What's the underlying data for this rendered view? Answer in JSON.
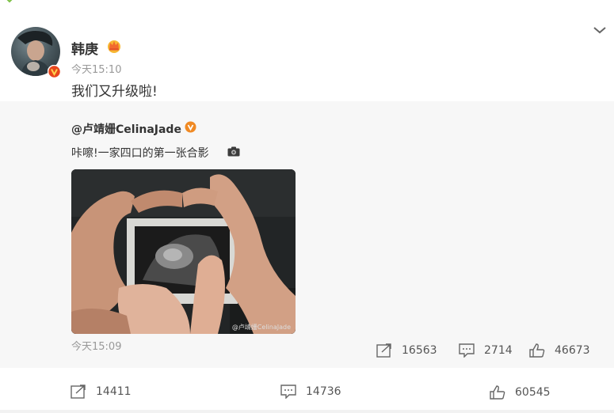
{
  "post": {
    "username": "韩庚",
    "time": "今天15:10",
    "text": "我们又升级啦!",
    "icons": {
      "avatar": "avatar-photo",
      "verified": "verified-v-icon",
      "crown": "crown-icon",
      "menu": "chevron-down-icon"
    }
  },
  "repost": {
    "author": "@卢靖姗CelinaJade",
    "text": "咔嚓!一家四口的第一张合影",
    "image_watermark": "@卢靖姗CelinaJade",
    "time": "今天15:09",
    "stats": {
      "share": "16563",
      "comment": "2714",
      "like": "46673"
    }
  },
  "actions": {
    "share": "14411",
    "comment": "14736",
    "like": "60545"
  },
  "colors": {
    "accent_orange": "#f08a24",
    "verified_badge": "#e8461c",
    "repost_bg": "#f7f7f7",
    "muted_text": "#999999"
  }
}
